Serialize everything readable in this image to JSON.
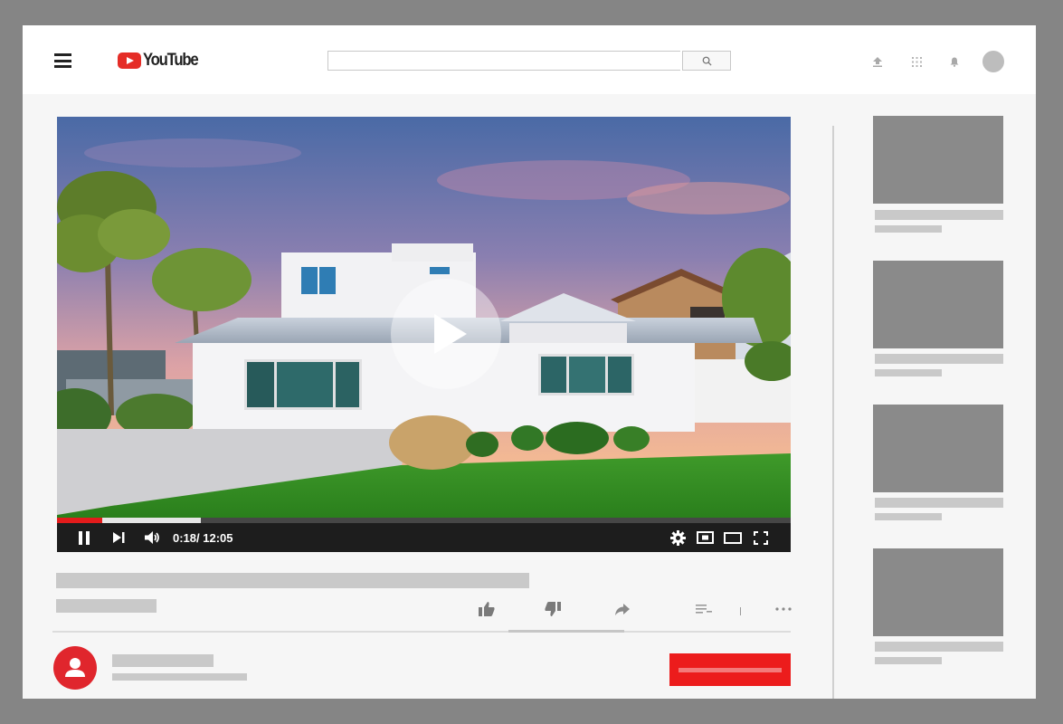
{
  "app": {
    "brand": "YouTube"
  },
  "header": {
    "search": {
      "value": "",
      "placeholder": ""
    },
    "icons": [
      "menu-icon",
      "youtube-logo-icon",
      "search-icon",
      "upload-icon",
      "apps-grid-icon",
      "notification-bell-icon",
      "account-avatar"
    ]
  },
  "player": {
    "time": "0:18/ 12:05",
    "progress": {
      "played_fraction": 0.062,
      "buffered_fraction": 0.196
    },
    "controls": [
      "pause-icon",
      "next-icon",
      "volume-icon",
      "settings-gear-icon",
      "miniplayer-icon",
      "theater-mode-icon",
      "fullscreen-icon"
    ]
  },
  "video_actions": [
    "like-icon",
    "dislike-icon",
    "share-icon",
    "save-to-playlist-icon",
    "more-icon"
  ],
  "sidebar": {
    "recommended_count": 4
  },
  "colors": {
    "brand_red": "#e52d27",
    "progress_red": "#e31b1b",
    "subscribe_red": "#ec1c1c",
    "placeholder_gray": "#c9c9c9",
    "thumbnail_gray": "#8a8a8a",
    "outer_background": "#858585"
  }
}
